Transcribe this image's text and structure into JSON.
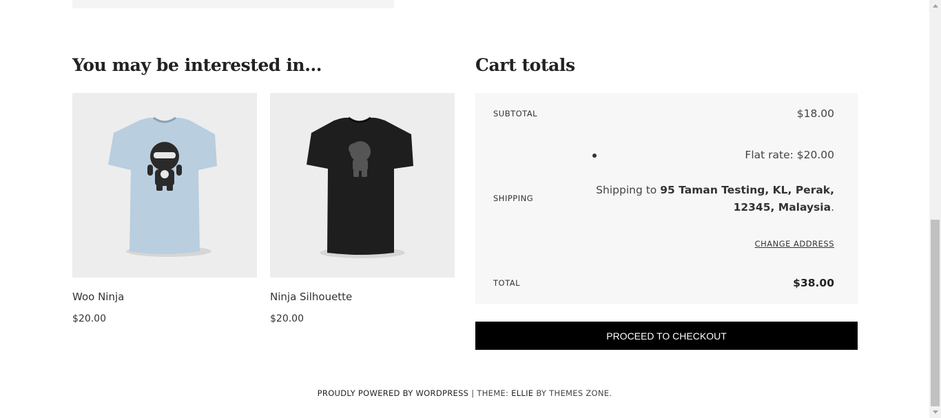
{
  "related": {
    "heading": "You may be interested in...",
    "products": [
      {
        "name": "Woo Ninja",
        "price": "$20.00",
        "shirt_color": "#b9cedf",
        "print_color": "#2a2a2a"
      },
      {
        "name": "Ninja Silhouette",
        "price": "$20.00",
        "shirt_color": "#1e1e1e",
        "print_color": "#555555"
      }
    ]
  },
  "cart": {
    "heading": "Cart totals",
    "subtotal_label": "SUBTOTAL",
    "subtotal_value": "$18.00",
    "shipping_label": "SHIPPING",
    "shipping_option": "Flat rate: $20.00",
    "shipping_to_prefix": "Shipping to",
    "shipping_address": "95 Taman Testing, KL, Perak, 12345, Malaysia",
    "shipping_suffix": ".",
    "change_address": "CHANGE ADDRESS",
    "total_label": "TOTAL",
    "total_value": "$38.00",
    "checkout_label": "PROCEED TO CHECKOUT"
  },
  "footer": {
    "powered_by": "PROUDLY POWERED BY WORDPRESS",
    "separator": " | ",
    "theme_prefix": "THEME: ",
    "theme_name": "ELLIE",
    "theme_by": " BY THEMES ZONE."
  },
  "colors": {
    "accent_button": "#000000",
    "panel_background": "#f7f7f7",
    "image_background": "#ededed"
  },
  "icons": {
    "scroll_up": "triangle-up-icon",
    "scroll_down": "triangle-down-icon"
  }
}
